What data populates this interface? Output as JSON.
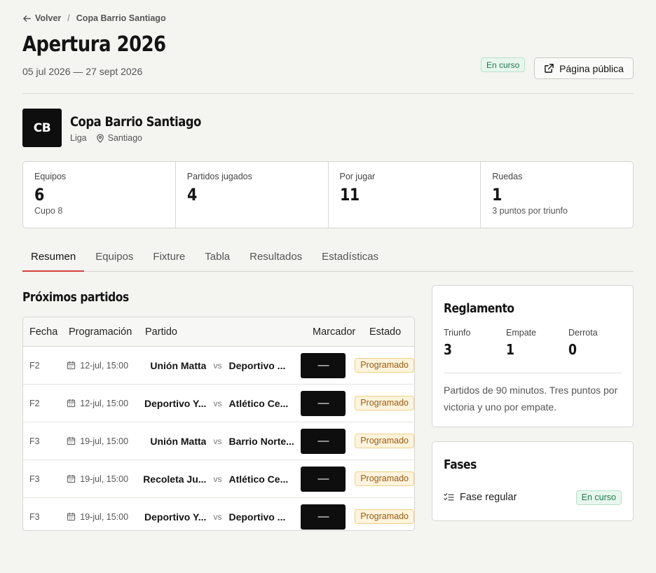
{
  "breadcrumb": {
    "back_label": "Volver",
    "separator": "/",
    "current": "Copa Barrio Santiago"
  },
  "header": {
    "title": "Apertura 2026",
    "date_range": "05 jul 2026 — 27 sept 2026",
    "status": "En curso",
    "public_page_label": "Página pública"
  },
  "organization": {
    "initials": "CB",
    "name": "Copa Barrio Santiago",
    "type": "Liga",
    "location": "Santiago"
  },
  "stats": [
    {
      "label": "Equipos",
      "value": "6",
      "sub": "Cupo 8"
    },
    {
      "label": "Partidos jugados",
      "value": "4",
      "sub": ""
    },
    {
      "label": "Por jugar",
      "value": "11",
      "sub": ""
    },
    {
      "label": "Ruedas",
      "value": "1",
      "sub": "3 puntos por triunfo"
    }
  ],
  "tabs": [
    {
      "label": "Resumen",
      "active": true
    },
    {
      "label": "Equipos",
      "active": false
    },
    {
      "label": "Fixture",
      "active": false
    },
    {
      "label": "Tabla",
      "active": false
    },
    {
      "label": "Resultados",
      "active": false
    },
    {
      "label": "Estadísticas",
      "active": false
    }
  ],
  "matches": {
    "title": "Próximos partidos",
    "columns": {
      "fecha": "Fecha",
      "programacion": "Programación",
      "partido": "Partido",
      "marcador": "Marcador",
      "estado": "Estado"
    },
    "rows": [
      {
        "round": "F2",
        "schedule": "12-jul, 15:00",
        "home": "Unión Matta",
        "vs": "vs",
        "away": "Deportivo ...",
        "score": "—",
        "status": "Programado"
      },
      {
        "round": "F2",
        "schedule": "12-jul, 15:00",
        "home": "Deportivo Y...",
        "vs": "vs",
        "away": "Atlético Ce...",
        "score": "—",
        "status": "Programado"
      },
      {
        "round": "F3",
        "schedule": "19-jul, 15:00",
        "home": "Unión Matta",
        "vs": "vs",
        "away": "Barrio Norte...",
        "score": "—",
        "status": "Programado"
      },
      {
        "round": "F3",
        "schedule": "19-jul, 15:00",
        "home": "Recoleta Ju...",
        "vs": "vs",
        "away": "Atlético Ce...",
        "score": "—",
        "status": "Programado"
      },
      {
        "round": "F3",
        "schedule": "19-jul, 15:00",
        "home": "Deportivo Y...",
        "vs": "vs",
        "away": "Deportivo ...",
        "score": "—",
        "status": "Programado"
      }
    ]
  },
  "rules": {
    "title": "Reglamento",
    "items": [
      {
        "label": "Triunfo",
        "value": "3"
      },
      {
        "label": "Empate",
        "value": "1"
      },
      {
        "label": "Derrota",
        "value": "0"
      }
    ],
    "description": "Partidos de 90 minutos. Tres puntos por victoria y uno por empate."
  },
  "phases": {
    "title": "Fases",
    "items": [
      {
        "name": "Fase regular",
        "status": "En curso"
      }
    ]
  },
  "colors": {
    "accent": "#d6413a",
    "success": "#1d7a4a",
    "warning": "#9a5a10",
    "dark": "#0e0e0e",
    "background": "#f4f4f1"
  }
}
